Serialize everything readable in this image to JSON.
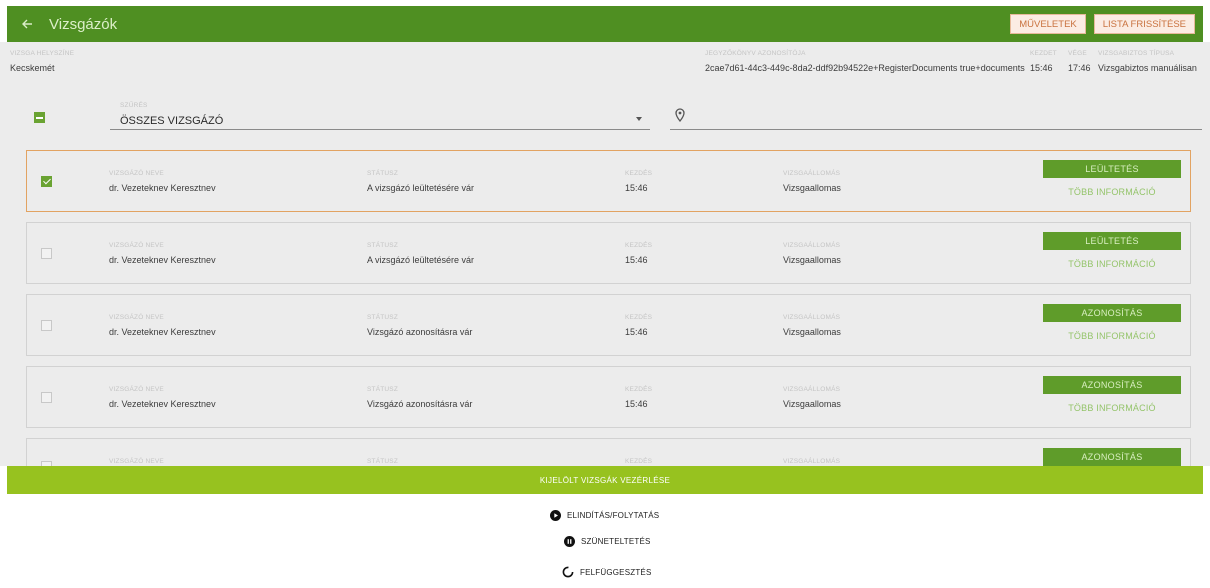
{
  "header": {
    "title": "Vizsgázók",
    "actions_label": "MŰVELETEK",
    "refresh_label": "LISTA FRISSÍTÉSE"
  },
  "info": {
    "location_label": "VIZSGA HELYSZÍNE",
    "location_value": "Kecskemét",
    "record_label": "JEGYZŐKÖNYV AZONOSÍTÓJA",
    "record_value": "2cae7d61-44c3-449c-8da2-ddf92b94522e+RegisterDocuments true+documents",
    "start_label": "KEZDET",
    "start_value": "15:46",
    "end_label": "VÉGE",
    "end_value": "17:46",
    "proctor_label": "VIZSGABIZTOS TÍPUSA",
    "proctor_value": "Vizsgabiztos manuálisan"
  },
  "filter": {
    "label": "SZŰRÉS",
    "selected": "ÖSSZES VIZSGÁZÓ"
  },
  "columns": {
    "name": "VIZSGÁZÓ NEVE",
    "status": "STÁTUSZ",
    "start": "KEZDÉS",
    "station": "VIZSGAÁLLOMÁS"
  },
  "rows": [
    {
      "name": "dr. Vezeteknev Keresztnev",
      "status": "A vizsgázó leültetésére vár",
      "start": "15:46",
      "station": "Vizsgaallomas",
      "action": "LEÜLTETÉS",
      "more": "TÖBB INFORMÁCIÓ",
      "checked": true
    },
    {
      "name": "dr. Vezeteknev Keresztnev",
      "status": "A vizsgázó leültetésére vár",
      "start": "15:46",
      "station": "Vizsgaallomas",
      "action": "LEÜLTETÉS",
      "more": "TÖBB INFORMÁCIÓ",
      "checked": false
    },
    {
      "name": "dr. Vezeteknev Keresztnev",
      "status": "Vizsgázó azonosításra vár",
      "start": "15:46",
      "station": "Vizsgaallomas",
      "action": "AZONOSÍTÁS",
      "more": "TÖBB INFORMÁCIÓ",
      "checked": false
    },
    {
      "name": "dr. Vezeteknev Keresztnev",
      "status": "Vizsgázó azonosításra vár",
      "start": "15:46",
      "station": "Vizsgaallomas",
      "action": "AZONOSÍTÁS",
      "more": "TÖBB INFORMÁCIÓ",
      "checked": false
    },
    {
      "name": "",
      "status": "",
      "start": "",
      "station": "",
      "action": "AZONOSÍTÁS",
      "more": "",
      "checked": false
    }
  ],
  "bottom": {
    "bar_label": "KIJELÖLT VIZSGÁK VEZÉRLÉSE",
    "start_resume": "ELINDÍTÁS/FOLYTATÁS",
    "pause": "SZÜNETELTETÉS",
    "suspend": "FELFÜGGESZTÉS"
  },
  "colors": {
    "header_green": "#4f8f22",
    "bar_green": "#97c21f",
    "accent_orange": "#c9723f"
  },
  "icons": {
    "back": "arrow-left-icon",
    "location": "map-pin-icon",
    "play": "play-circle-icon",
    "pause": "pause-circle-icon",
    "suspend": "spinner-icon"
  }
}
